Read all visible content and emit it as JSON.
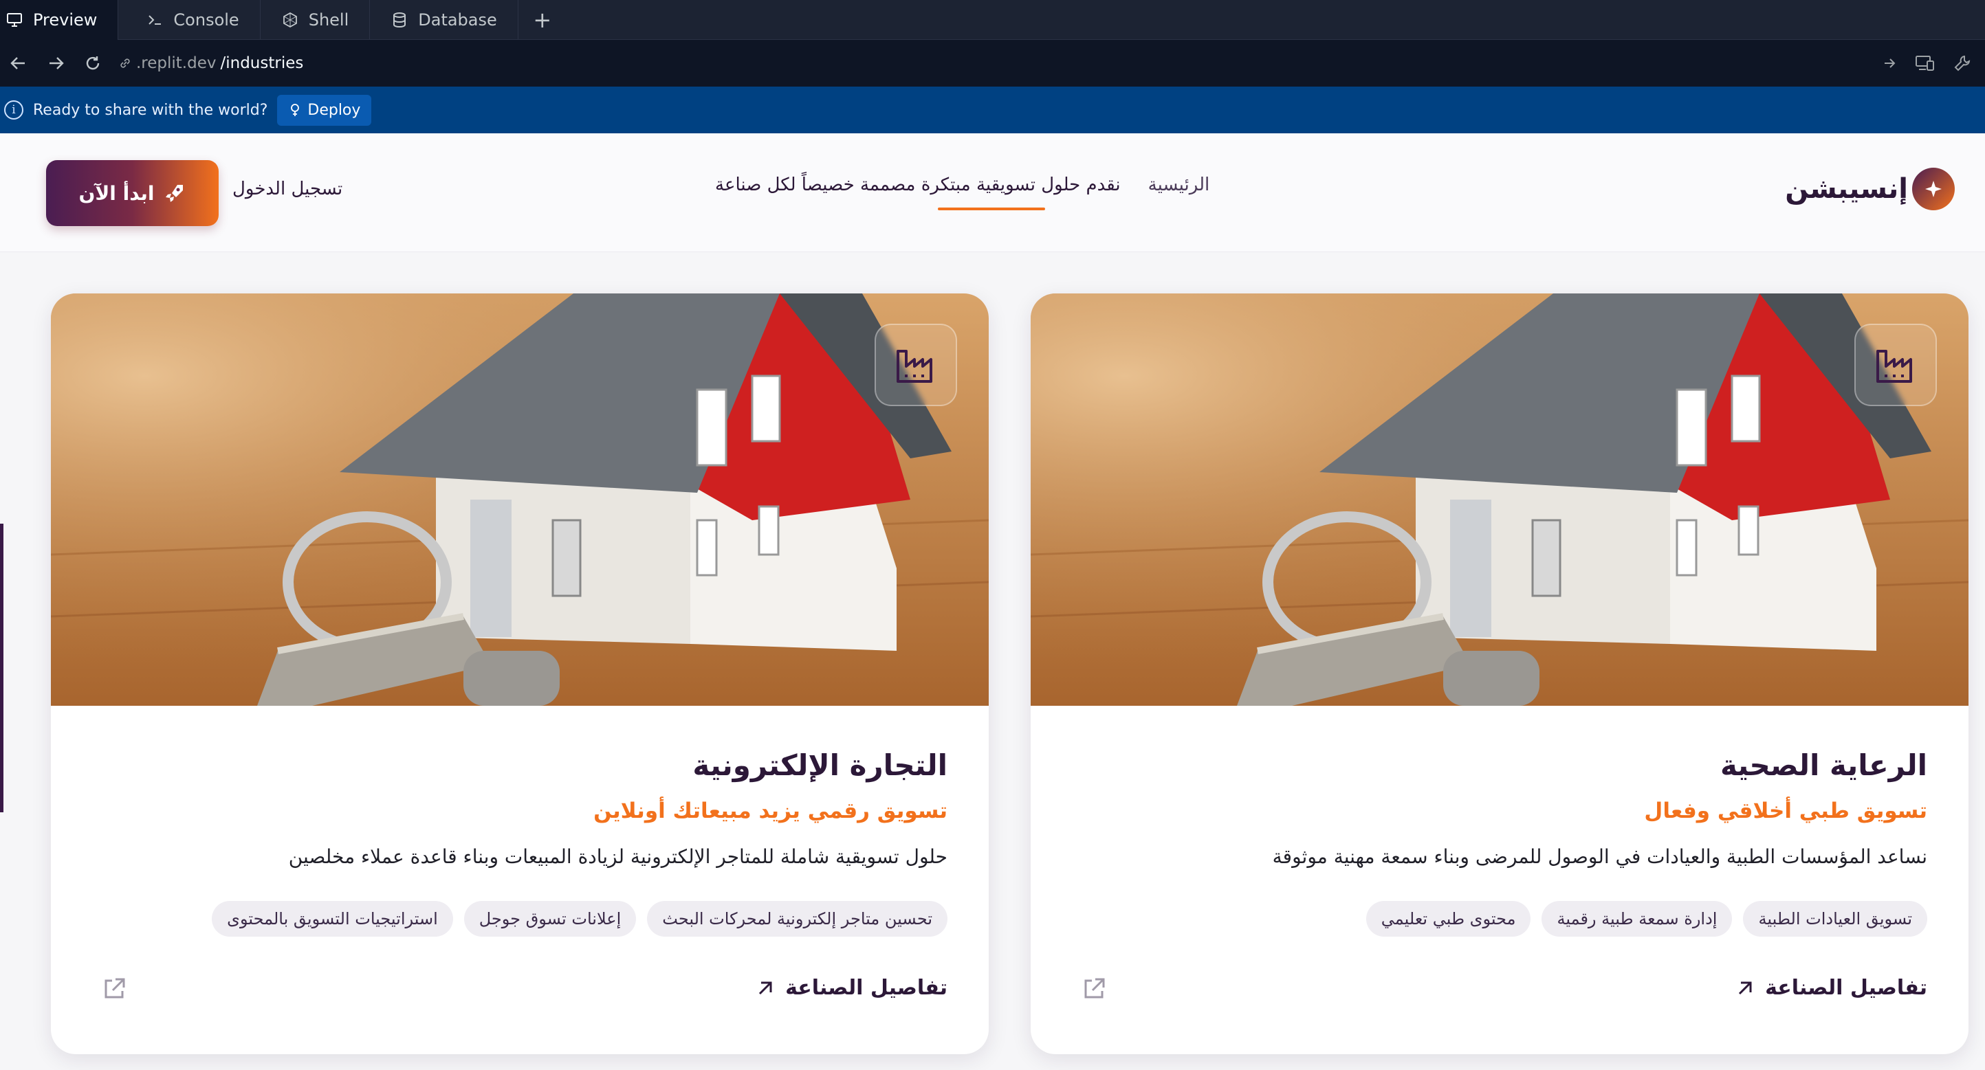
{
  "tabs": [
    {
      "label": "Preview",
      "icon": "monitor-icon"
    },
    {
      "label": "Console",
      "icon": "terminal-icon"
    },
    {
      "label": "Shell",
      "icon": "shell-icon"
    },
    {
      "label": "Database",
      "icon": "database-icon"
    }
  ],
  "url": {
    "prefix": ".replit.dev",
    "path": "/industries"
  },
  "deploy": {
    "message": "Ready to share with the world?",
    "button": "Deploy"
  },
  "site": {
    "logo": "إنسيبشن",
    "nav": {
      "home": "الرئيسية",
      "current": "نقدم حلول تسويقية مبتكرة مصممة خصيصاً لكل صناعة"
    },
    "login": "تسجيل الدخول",
    "start": "ابدأ الآن"
  },
  "cards": [
    {
      "title": "الرعاية الصحية",
      "subtitle": "تسويق طبي أخلاقي وفعال",
      "description": "نساعد المؤسسات الطبية والعيادات في الوصول للمرضى وبناء سمعة مهنية موثوقة",
      "tags": [
        "تسويق العيادات الطبية",
        "إدارة سمعة طبية رقمية",
        "محتوى طبي تعليمي"
      ],
      "details": "تفاصيل الصناعة"
    },
    {
      "title": "التجارة الإلكترونية",
      "subtitle": "تسويق رقمي يزيد مبيعاتك أونلاين",
      "description": "حلول تسويقية شاملة للمتاجر الإلكترونية لزيادة المبيعات وبناء قاعدة عملاء مخلصين",
      "tags": [
        "تحسين متاجر إلكترونية لمحركات البحث",
        "إعلانات تسوق جوجل",
        "استراتيجيات التسويق بالمحتوى"
      ],
      "details": "تفاصيل الصناعة"
    }
  ],
  "colors": {
    "brand_dark": "#2c1838",
    "accent": "#f2711c",
    "replit_bg": "#0e1525",
    "deploy_bar": "#004182"
  }
}
